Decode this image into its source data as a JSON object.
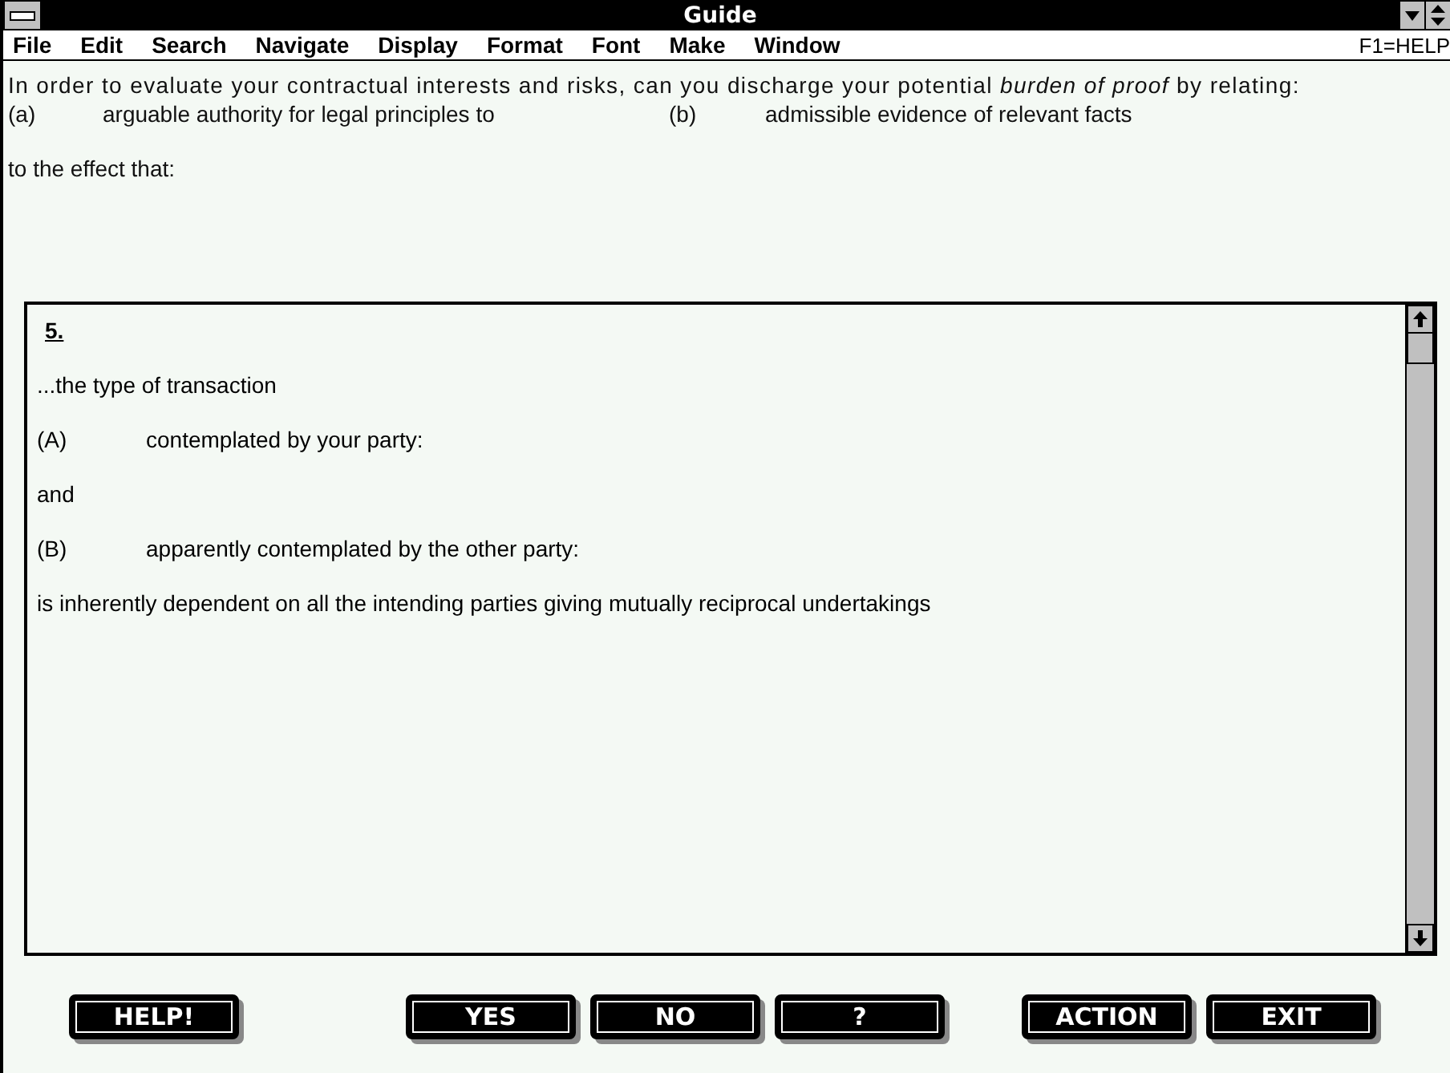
{
  "window": {
    "title": "Guide"
  },
  "menu": [
    "File",
    "Edit",
    "Search",
    "Navigate",
    "Display",
    "Format",
    "Font",
    "Make",
    "Window"
  ],
  "help_hint": "F1=HELP",
  "prompt": {
    "intro": "In order to evaluate your contractual interests and risks, can you discharge your potential *burden of proof* by relating:",
    "options": [
      {
        "label": "(a)",
        "text": "arguable authority for legal principles to"
      },
      {
        "label": "(b)",
        "text": "admissible evidence of relevant facts"
      }
    ],
    "outro": "to the effect that:"
  },
  "content": {
    "heading": "5.",
    "items": [
      {
        "kind": "para",
        "text": "...the type of transaction"
      },
      {
        "kind": "labeled",
        "label": "(A)",
        "text": "contemplated by your party:"
      },
      {
        "kind": "para",
        "text": "and"
      },
      {
        "kind": "labeled",
        "label": "(B)",
        "text": "apparently contemplated by the other party:"
      },
      {
        "kind": "para",
        "text": "is inherently dependent on all the intending parties giving mutually reciprocal undertakings"
      }
    ]
  },
  "button_groups": [
    [
      "HELP!"
    ],
    [
      "YES",
      "NO",
      "?"
    ],
    [
      "ACTION",
      "EXIT"
    ]
  ]
}
